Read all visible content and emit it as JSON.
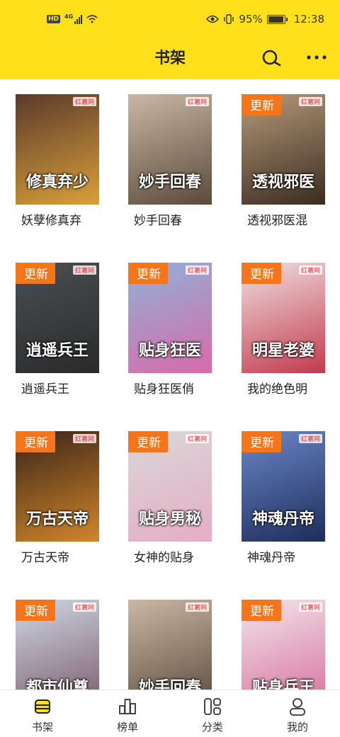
{
  "status": {
    "network": "4G",
    "hd": "HD",
    "battery": "95%",
    "battery_level": 0.95,
    "time": "12:38"
  },
  "header": {
    "title": "书架",
    "search_icon": "search-icon",
    "more_icon": "more-icon"
  },
  "colors": {
    "accent": "#FFE01B",
    "badge": "#F5761A"
  },
  "books": [
    {
      "title": "妖孽修真弃",
      "cover_text": "修真弃少",
      "badge": ""
    },
    {
      "title": "妙手回春",
      "cover_text": "妙手回春",
      "badge": ""
    },
    {
      "title": "透视邪医混",
      "cover_text": "透视邪医",
      "badge": "更新"
    },
    {
      "title": "逍遥兵王",
      "cover_text": "逍遥兵王",
      "badge": "更新"
    },
    {
      "title": "贴身狂医俏",
      "cover_text": "贴身狂医",
      "badge": "更新"
    },
    {
      "title": "我的绝色明",
      "cover_text": "明星老婆",
      "badge": "更新"
    },
    {
      "title": "万古天帝",
      "cover_text": "万古天帝",
      "badge": "更新"
    },
    {
      "title": "女神的贴身",
      "cover_text": "贴身男秘",
      "badge": "更新"
    },
    {
      "title": "神魂丹帝",
      "cover_text": "神魂丹帝",
      "badge": "更新"
    },
    {
      "title": "",
      "cover_text": "都市仙尊",
      "badge": "更新"
    },
    {
      "title": "",
      "cover_text": "妙手回春",
      "badge": ""
    },
    {
      "title": "",
      "cover_text": "贴身兵王",
      "badge": "更新"
    }
  ],
  "cover_logo": "红薯网",
  "tabs": [
    {
      "label": "书架",
      "icon": "bookshelf-icon",
      "active": true
    },
    {
      "label": "榜单",
      "icon": "ranking-icon",
      "active": false
    },
    {
      "label": "分类",
      "icon": "category-icon",
      "active": false
    },
    {
      "label": "我的",
      "icon": "profile-icon",
      "active": false
    }
  ]
}
